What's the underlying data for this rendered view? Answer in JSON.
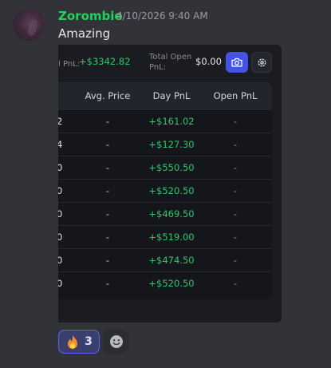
{
  "message": {
    "username": "Zorombie",
    "timestamp": "4/10/2026 9:40 AM",
    "text": "Amazing"
  },
  "embed": {
    "pnl_label": "l PnL:",
    "pnl_value": "+$3342.82",
    "open_pnl_label": "Total Open PnL:",
    "open_pnl_value": "$0.00",
    "buttons": {
      "camera_icon": "camera-icon",
      "settings_icon": "gear-icon"
    },
    "table": {
      "headers": [
        "Avg. Price",
        "Day PnL",
        "Open PnL"
      ],
      "rows": [
        {
          "qty": "2",
          "avg": "-",
          "day": "+$161.02",
          "open": "-"
        },
        {
          "qty": "4",
          "avg": "-",
          "day": "+$127.30",
          "open": "-"
        },
        {
          "qty": "0",
          "avg": "-",
          "day": "+$550.50",
          "open": "-"
        },
        {
          "qty": "0",
          "avg": "-",
          "day": "+$520.50",
          "open": "-"
        },
        {
          "qty": "0",
          "avg": "-",
          "day": "+$469.50",
          "open": "-"
        },
        {
          "qty": "0",
          "avg": "-",
          "day": "+$519.00",
          "open": "-"
        },
        {
          "qty": "0",
          "avg": "-",
          "day": "+$474.50",
          "open": "-"
        },
        {
          "qty": "0",
          "avg": "-",
          "day": "+$520.50",
          "open": "-"
        }
      ]
    }
  },
  "reactions": [
    {
      "emoji": "fire-icon",
      "count": "3"
    }
  ],
  "add_reaction_icon": "smiley-icon",
  "colors": {
    "username": "#1fd35c",
    "positive": "#2ec86a",
    "accent": "#4453e3"
  }
}
